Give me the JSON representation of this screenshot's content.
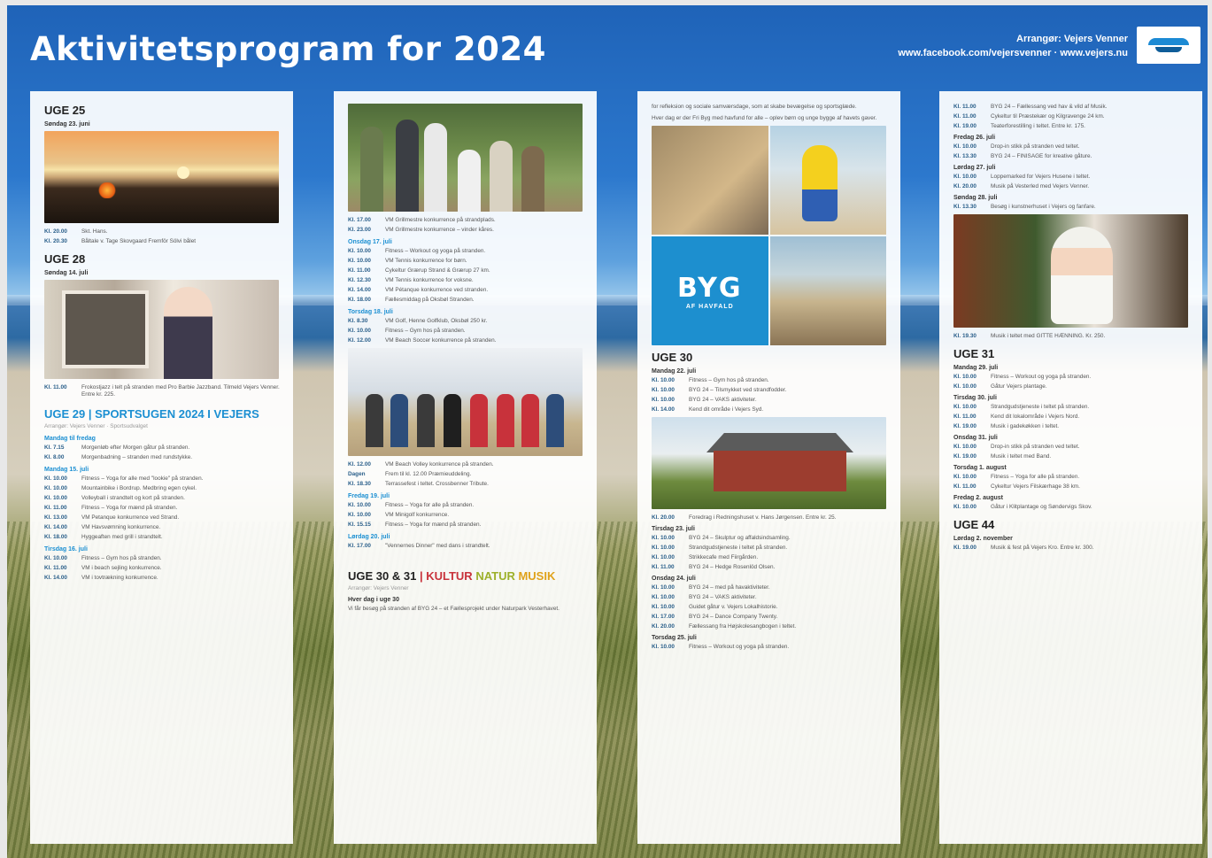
{
  "header": {
    "title": "Aktivitetsprogram for 2024",
    "organizer_line": "Arrangør: Vejers Venner",
    "links_line": "www.facebook.com/vejersvenner · www.vejers.nu"
  },
  "col1": {
    "uge25": "UGE 25",
    "uge25_day": "Søndag 23. juni",
    "uge25_rows": [
      {
        "time": "Kl. 20.00",
        "text": "Skt. Hans."
      },
      {
        "time": "Kl. 20.30",
        "text": "Båltale v. Tage Skovgaard Fremför Sölvi bålet"
      }
    ],
    "uge28": "UGE 28",
    "uge28_day": "Søndag 14. juli",
    "uge28_rows": [
      {
        "time": "Kl. 11.00",
        "text": "Frokostjazz i telt på stranden med Pro Barbie Jazzband. Tilmeld Vejers Venner. Entre kr. 225."
      }
    ],
    "uge29_title": "UGE 29 | SPORTSUGEN 2024 I VEJERS",
    "uge29_sub": "Arrangør: Vejers Venner · Sportsudvalget",
    "uge29_day1": "Mandag til fredag",
    "uge29_rows1": [
      {
        "time": "Kl. 7.15",
        "text": "Morgenløb efter Morgen gåtur på stranden."
      },
      {
        "time": "Kl. 8.00",
        "text": "Morgenbadning – stranden med rundstykke."
      }
    ],
    "uge29_day2": "Mandag 15. juli",
    "uge29_rows2": [
      {
        "time": "Kl. 10.00",
        "text": "Fitness – Yoga for alle med \"lookie\" på stranden."
      },
      {
        "time": "Kl. 10.00",
        "text": "Mountainbike i Bordrup. Medbring egen cykel."
      },
      {
        "time": "Kl. 10.00",
        "text": "Volleyball i strandtelt og kort på stranden."
      },
      {
        "time": "Kl. 11.00",
        "text": "Fitness – Yoga for mænd på stranden."
      },
      {
        "time": "Kl. 13.00",
        "text": "VM Petanque konkurrence ved Strand."
      },
      {
        "time": "Kl. 14.00",
        "text": "VM Havsvømning konkurrence."
      },
      {
        "time": "Kl. 18.00",
        "text": "Hyggeaften med grill i strandtelt."
      }
    ],
    "uge29_day3": "Tirsdag 16. juli",
    "uge29_rows3": [
      {
        "time": "Kl. 10.00",
        "text": "Fitness – Gym hos på stranden."
      },
      {
        "time": "Kl. 11.00",
        "text": "VM i beach sejling konkurrence."
      },
      {
        "time": "Kl. 14.00",
        "text": "VM i tovtrækning konkurrence."
      }
    ]
  },
  "col2": {
    "rows1": [
      {
        "time": "Kl. 17.00",
        "text": "VM Grillmestre konkurrence på strandplads."
      },
      {
        "time": "Kl. 23.00",
        "text": "VM Grillmestre konkurrence – vinder kåres."
      }
    ],
    "day1": "Onsdag 17. juli",
    "rows2": [
      {
        "time": "Kl. 10.00",
        "text": "Fitness – Workout og yoga på stranden."
      },
      {
        "time": "Kl. 10.00",
        "text": "VM Tennis konkurrence for børn."
      },
      {
        "time": "Kl. 11.00",
        "text": "Cykeltur Grærup Strand & Grærup 27 km."
      },
      {
        "time": "Kl. 12.30",
        "text": "VM Tennis konkurrence for voksne."
      },
      {
        "time": "Kl. 14.00",
        "text": "VM Pétanque konkurrence ved stranden."
      },
      {
        "time": "Kl. 18.00",
        "text": "Fællesmiddag på Oksbøl Stranden."
      }
    ],
    "day2": "Torsdag 18. juli",
    "rows3": [
      {
        "time": "Kl. 8.30",
        "text": "VM Golf, Henne Golfklub, Oksbøl 250 kr."
      },
      {
        "time": "Kl. 10.00",
        "text": "Fitness – Gym hos på stranden."
      },
      {
        "time": "Kl. 12.00",
        "text": "VM Beach Soccer konkurrence på stranden."
      }
    ],
    "rows4": [
      {
        "time": "Kl. 12.00",
        "text": "VM Beach Volley konkurrence på stranden."
      },
      {
        "time": "Dagen",
        "text": "Frem til kl. 12.00 Præmieuddeling."
      },
      {
        "time": "Kl. 18.30",
        "text": "Terrassefest i teltet. Crossbenner Tribute."
      }
    ],
    "day3": "Fredag 19. juli",
    "rows5": [
      {
        "time": "Kl. 10.00",
        "text": "Fitness – Yoga for alle på stranden."
      },
      {
        "time": "Kl. 10.00",
        "text": "VM Minigolf konkurrence."
      },
      {
        "time": "Kl. 15.15",
        "text": "Fitness – Yoga for mænd på stranden."
      }
    ],
    "day4": "Lørdag 20. juli",
    "rows6": [
      {
        "time": "Kl. 17.00",
        "text": "\"Vennernes Dinner\" med dans i strandtelt."
      }
    ],
    "uge3031": "UGE 30 & 31",
    "uge3031_kultur": "KULTUR",
    "uge3031_natur": "NATUR",
    "uge3031_musik": "MUSIK",
    "uge3031_sub": "Arrangør: Vejers Venner",
    "uge3031_day": "Hver dag i uge 30",
    "uge3031_text": "Vi får besøg på stranden af BYG 24 – et Fællesprojekt under Naturpark Vesterhavet."
  },
  "col3": {
    "intro": "for refleksion og sociale samværsdage, som at skabe bevægelse og sportsglæde.",
    "intro2": "Hver dag er der Fri Byg med havfund for alle – oplev børn og unge bygge af havets gaver.",
    "byg": "BYG",
    "byg_sub": "AF HAVFALD",
    "uge30": "UGE 30",
    "day1": "Mandag 22. juli",
    "rows1": [
      {
        "time": "Kl. 10.00",
        "text": "Fitness – Gym hos på stranden."
      },
      {
        "time": "Kl. 10.00",
        "text": "BYG 24 – Tilsmykket ved strandfodder."
      },
      {
        "time": "Kl. 10.00",
        "text": "BYG 24 – VAKS aktiviteter."
      },
      {
        "time": "Kl. 14.00",
        "text": "Kend dit område i Vejers Syd."
      }
    ],
    "rows2": [
      {
        "time": "Kl. 20.00",
        "text": "Foredrag i Redningshuset v. Hans Jørgensen. Entre kr. 25."
      }
    ],
    "day2": "Tirsdag 23. juli",
    "rows3": [
      {
        "time": "Kl. 10.00",
        "text": "BYG 24 – Skulptur og affaldsindsamling."
      },
      {
        "time": "Kl. 10.00",
        "text": "Strandgudstjeneste i teltet på stranden."
      },
      {
        "time": "Kl. 10.00",
        "text": "Strikkecafe med Fiirgården."
      },
      {
        "time": "Kl. 11.00",
        "text": "BYG 24 – Hedge Rosenlöd Olsen."
      }
    ],
    "day3": "Onsdag 24. juli",
    "rows4": [
      {
        "time": "Kl. 10.00",
        "text": "BYG 24 – med på havaktiviteter."
      },
      {
        "time": "Kl. 10.00",
        "text": "BYG 24 – VAKS aktiviteter."
      },
      {
        "time": "Kl. 10.00",
        "text": "Guidet gåtur v. Vejers Lokalhistorie."
      },
      {
        "time": "Kl. 17.00",
        "text": "BYG 24 – Dance Company Twenty."
      },
      {
        "time": "Kl. 20.00",
        "text": "Fællessang fra Højskolesangbogen i teltet."
      }
    ],
    "day4": "Torsdag 25. juli",
    "rows5": [
      {
        "time": "Kl. 10.00",
        "text": "Fitness – Workout og yoga på stranden."
      }
    ]
  },
  "col4": {
    "rows1": [
      {
        "time": "Kl. 11.00",
        "text": "BYG 24 – Fællessang ved hav & vild af Musik."
      },
      {
        "time": "Kl. 11.00",
        "text": "Cykeltur til Præstekær og Kilgravenge 24 km."
      },
      {
        "time": "Kl. 19.00",
        "text": "Teaterforestilling i teltet. Entre kr. 175."
      }
    ],
    "day1": "Fredag 26. juli",
    "rows2": [
      {
        "time": "Kl. 10.00",
        "text": "Drop-in stikk på stranden ved teltet."
      },
      {
        "time": "Kl. 13.30",
        "text": "BYG 24 – FINISAGE for kreative gåture."
      }
    ],
    "day2": "Lørdag 27. juli",
    "rows3": [
      {
        "time": "Kl. 10.00",
        "text": "Loppemarked for Vejers Husene i teltet."
      },
      {
        "time": "Kl. 20.00",
        "text": "Musik på Vesterled med Vejers Venner."
      }
    ],
    "day3": "Søndag 28. juli",
    "rows4": [
      {
        "time": "Kl. 13.30",
        "text": "Besøg i kunstnerhuset i Vejers og fanfare."
      }
    ],
    "rows5": [
      {
        "time": "Kl. 19.30",
        "text": "Musik i teltet med GITTE HÆNNING. Kr. 250."
      }
    ],
    "uge31": "UGE 31",
    "day4": "Mandag 29. juli",
    "rows6": [
      {
        "time": "Kl. 10.00",
        "text": "Fitness – Workout og yoga på stranden."
      },
      {
        "time": "Kl. 10.00",
        "text": "Gåtur Vejers plantage."
      }
    ],
    "day5": "Tirsdag 30. juli",
    "rows7": [
      {
        "time": "Kl. 10.00",
        "text": "Strandgudstjeneste i teltet på stranden."
      },
      {
        "time": "Kl. 11.00",
        "text": "Kend dit lokalområde i Vejers Nord."
      },
      {
        "time": "Kl. 19.00",
        "text": "Musik i gadekøkken i teltet."
      }
    ],
    "day6": "Onsdag 31. juli",
    "rows8": [
      {
        "time": "Kl. 10.00",
        "text": "Drop-in stikk på stranden ved teltet."
      },
      {
        "time": "Kl. 19.00",
        "text": "Musik i teltet med Band."
      }
    ],
    "day7": "Torsdag 1. august",
    "rows9": [
      {
        "time": "Kl. 10.00",
        "text": "Fitness – Yoga for alle på stranden."
      },
      {
        "time": "Kl. 11.00",
        "text": "Cykeltur Vejers Filskærhage 38 km."
      }
    ],
    "day8": "Fredag 2. august",
    "rows10": [
      {
        "time": "Kl. 10.00",
        "text": "Gåtur i Klitplantage og Søndervigs Skov."
      }
    ],
    "uge44": "UGE 44",
    "day9": "Lørdag 2. november",
    "rows11": [
      {
        "time": "Kl. 19.00",
        "text": "Musik & fest på Vejers Kro. Entre kr. 300."
      }
    ]
  }
}
